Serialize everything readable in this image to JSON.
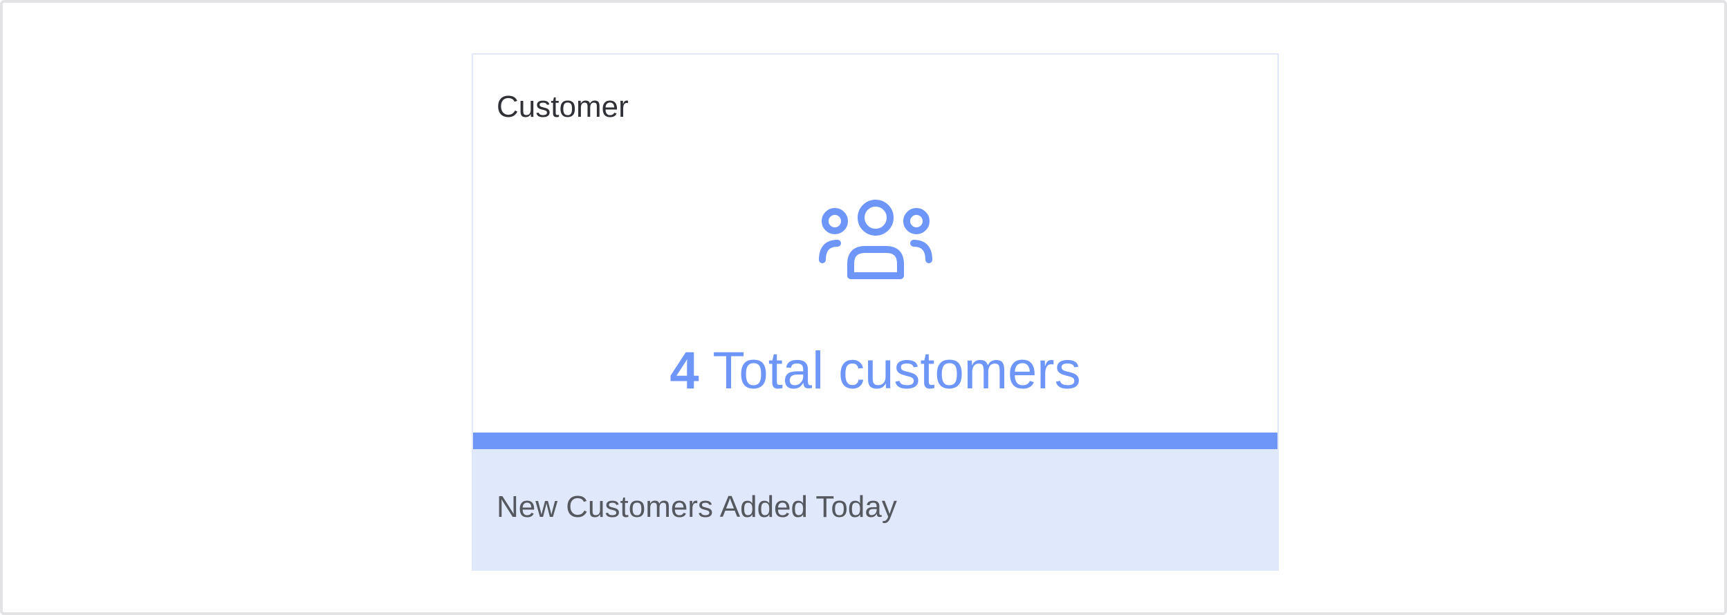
{
  "card": {
    "title": "Customer",
    "icon": "users-group-icon",
    "total_count": "4",
    "total_label": "Total customers",
    "footer_label": "New Customers Added Today"
  },
  "colors": {
    "accent": "#6e96f8",
    "footer_background": "#e0e8fb",
    "card_border": "#e2e8fb",
    "frame_border": "#e3e3e6"
  }
}
